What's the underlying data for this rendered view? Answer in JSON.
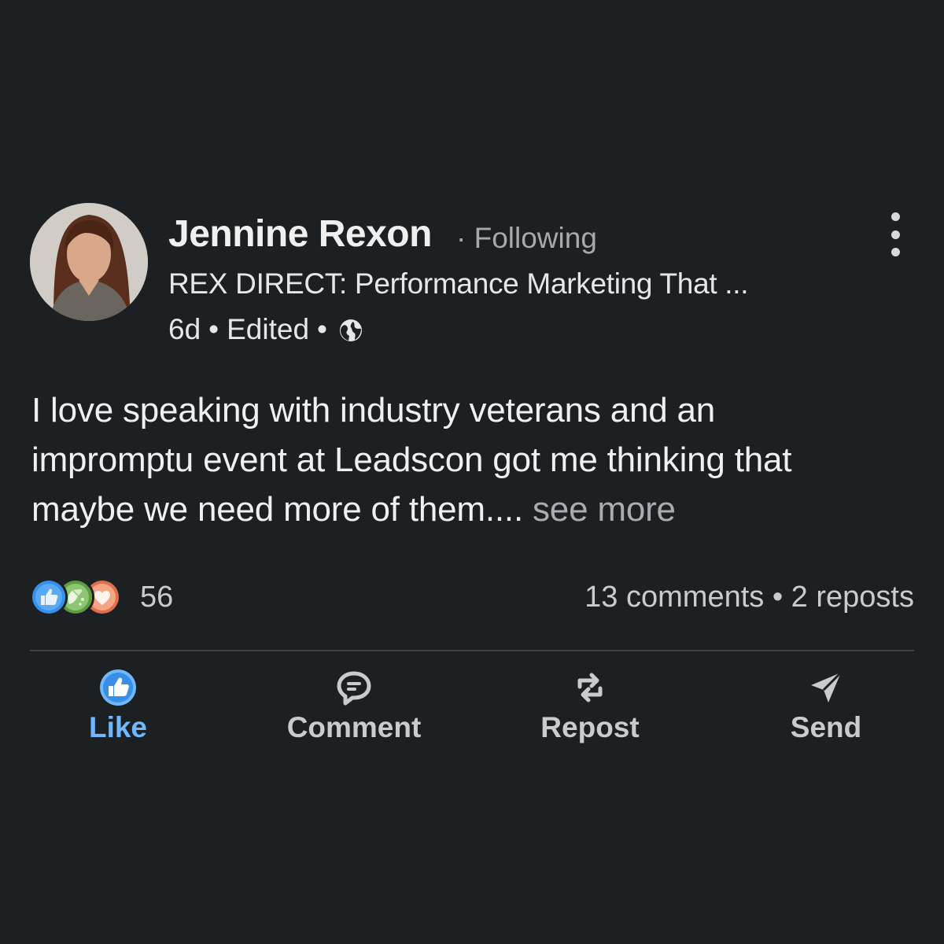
{
  "post": {
    "author": "Jennine Rexon",
    "follow_separator": "·",
    "follow_status": "Following",
    "headline": "REX DIRECT: Performance Marketing That ...",
    "time": "6d",
    "sep1": "•",
    "edited": "Edited",
    "sep2": "•",
    "visibility_icon": "globe-icon",
    "text_lines": [
      "I love speaking with industry veterans and an",
      "impromptu event at Leadscon got me thinking that",
      "maybe we need more of them.... "
    ],
    "see_more": "see more"
  },
  "social": {
    "reaction_icons": [
      "like-reaction-icon",
      "celebrate-reaction-icon",
      "love-reaction-icon"
    ],
    "reaction_count": "56",
    "stats": "13 comments • 2 reposts"
  },
  "actions": {
    "like": "Like",
    "comment": "Comment",
    "repost": "Repost",
    "send": "Send"
  },
  "colors": {
    "background": "#1d2023",
    "like_blue": "#71b7fb",
    "reaction_like": "#378fe9",
    "reaction_celebrate": "#5f9b41",
    "reaction_love": "#df704d"
  }
}
